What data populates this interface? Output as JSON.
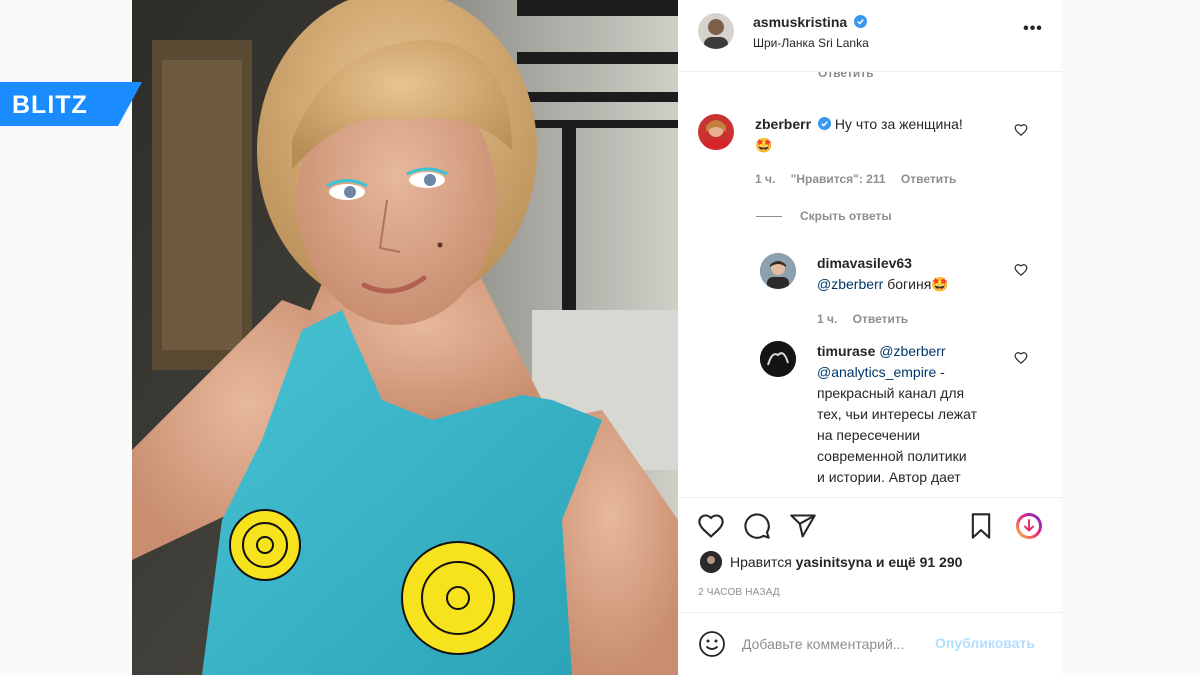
{
  "watermark": {
    "text": "BLITZ"
  },
  "post": {
    "author": "asmuskristina",
    "location": "Шри-Ланка Sri Lanka",
    "verified": true,
    "more_icon": "more-options-icon"
  },
  "comments": {
    "cut_off_reply": "Ответить",
    "items": [
      {
        "user": "zberberr",
        "verified": true,
        "text": "Ну что за женщина!",
        "emoji": "🤩",
        "time": "1 ч.",
        "likes": "\"Нравится\": 211",
        "reply": "Ответить"
      }
    ],
    "hide_replies": "Скрыть ответы",
    "replies": [
      {
        "user": "dimavasilev63",
        "mention": "@zberberr",
        "text": "богиня",
        "emoji": "🤩",
        "time": "1 ч.",
        "reply": "Ответить"
      },
      {
        "user": "timurase",
        "mention": "@zberberr",
        "mention2": "@analytics_empire",
        "text_lines": [
          "прекрасный канал для",
          "тех, чьи интересы лежат",
          "на пересечении",
          "современной политики",
          "и истории. Автор дает"
        ]
      }
    ]
  },
  "actions": {
    "like_icon": "heart-icon",
    "comment_icon": "comment-icon",
    "share_icon": "share-icon",
    "save_icon": "bookmark-icon",
    "download_icon": "download-icon"
  },
  "likes": {
    "prefix": "Нравится",
    "user": "yasinitsyna",
    "suffix": "и ещё 91 290"
  },
  "timestamp": "2 ЧАСОВ НАЗАД",
  "add_comment": {
    "placeholder": "Добавьте комментарий...",
    "post_label": "Опубликовать"
  },
  "colors": {
    "verified": "#3897f0",
    "link": "#00376b",
    "muted": "#8e8e8e",
    "post_button": "#b2dffc",
    "blitz_blue": "#1a8cff"
  }
}
